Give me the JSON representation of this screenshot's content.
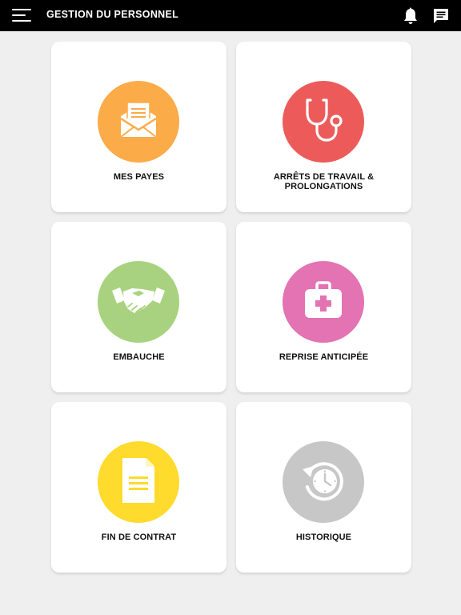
{
  "header": {
    "title": "GESTION DU PERSONNEL",
    "menu_icon": "hamburger-menu-icon",
    "notifications_icon": "bell-icon",
    "messages_icon": "chat-icon"
  },
  "tiles": [
    {
      "label": "MES PAYES",
      "icon": "envelope-letter-icon",
      "color": "#fbab48"
    },
    {
      "label": "ARRÊTS DE TRAVAIL & PROLONGATIONS",
      "icon": "stethoscope-icon",
      "color": "#ec5b5a"
    },
    {
      "label": "EMBAUCHE",
      "icon": "handshake-icon",
      "color": "#a8d27f"
    },
    {
      "label": "REPRISE ANTICIPÉE",
      "icon": "medical-kit-icon",
      "color": "#e373b3"
    },
    {
      "label": "FIN DE CONTRAT",
      "icon": "document-icon",
      "color": "#fedb2c"
    },
    {
      "label": "HISTORIQUE",
      "icon": "history-clock-icon",
      "color": "#c7c7c7"
    }
  ]
}
